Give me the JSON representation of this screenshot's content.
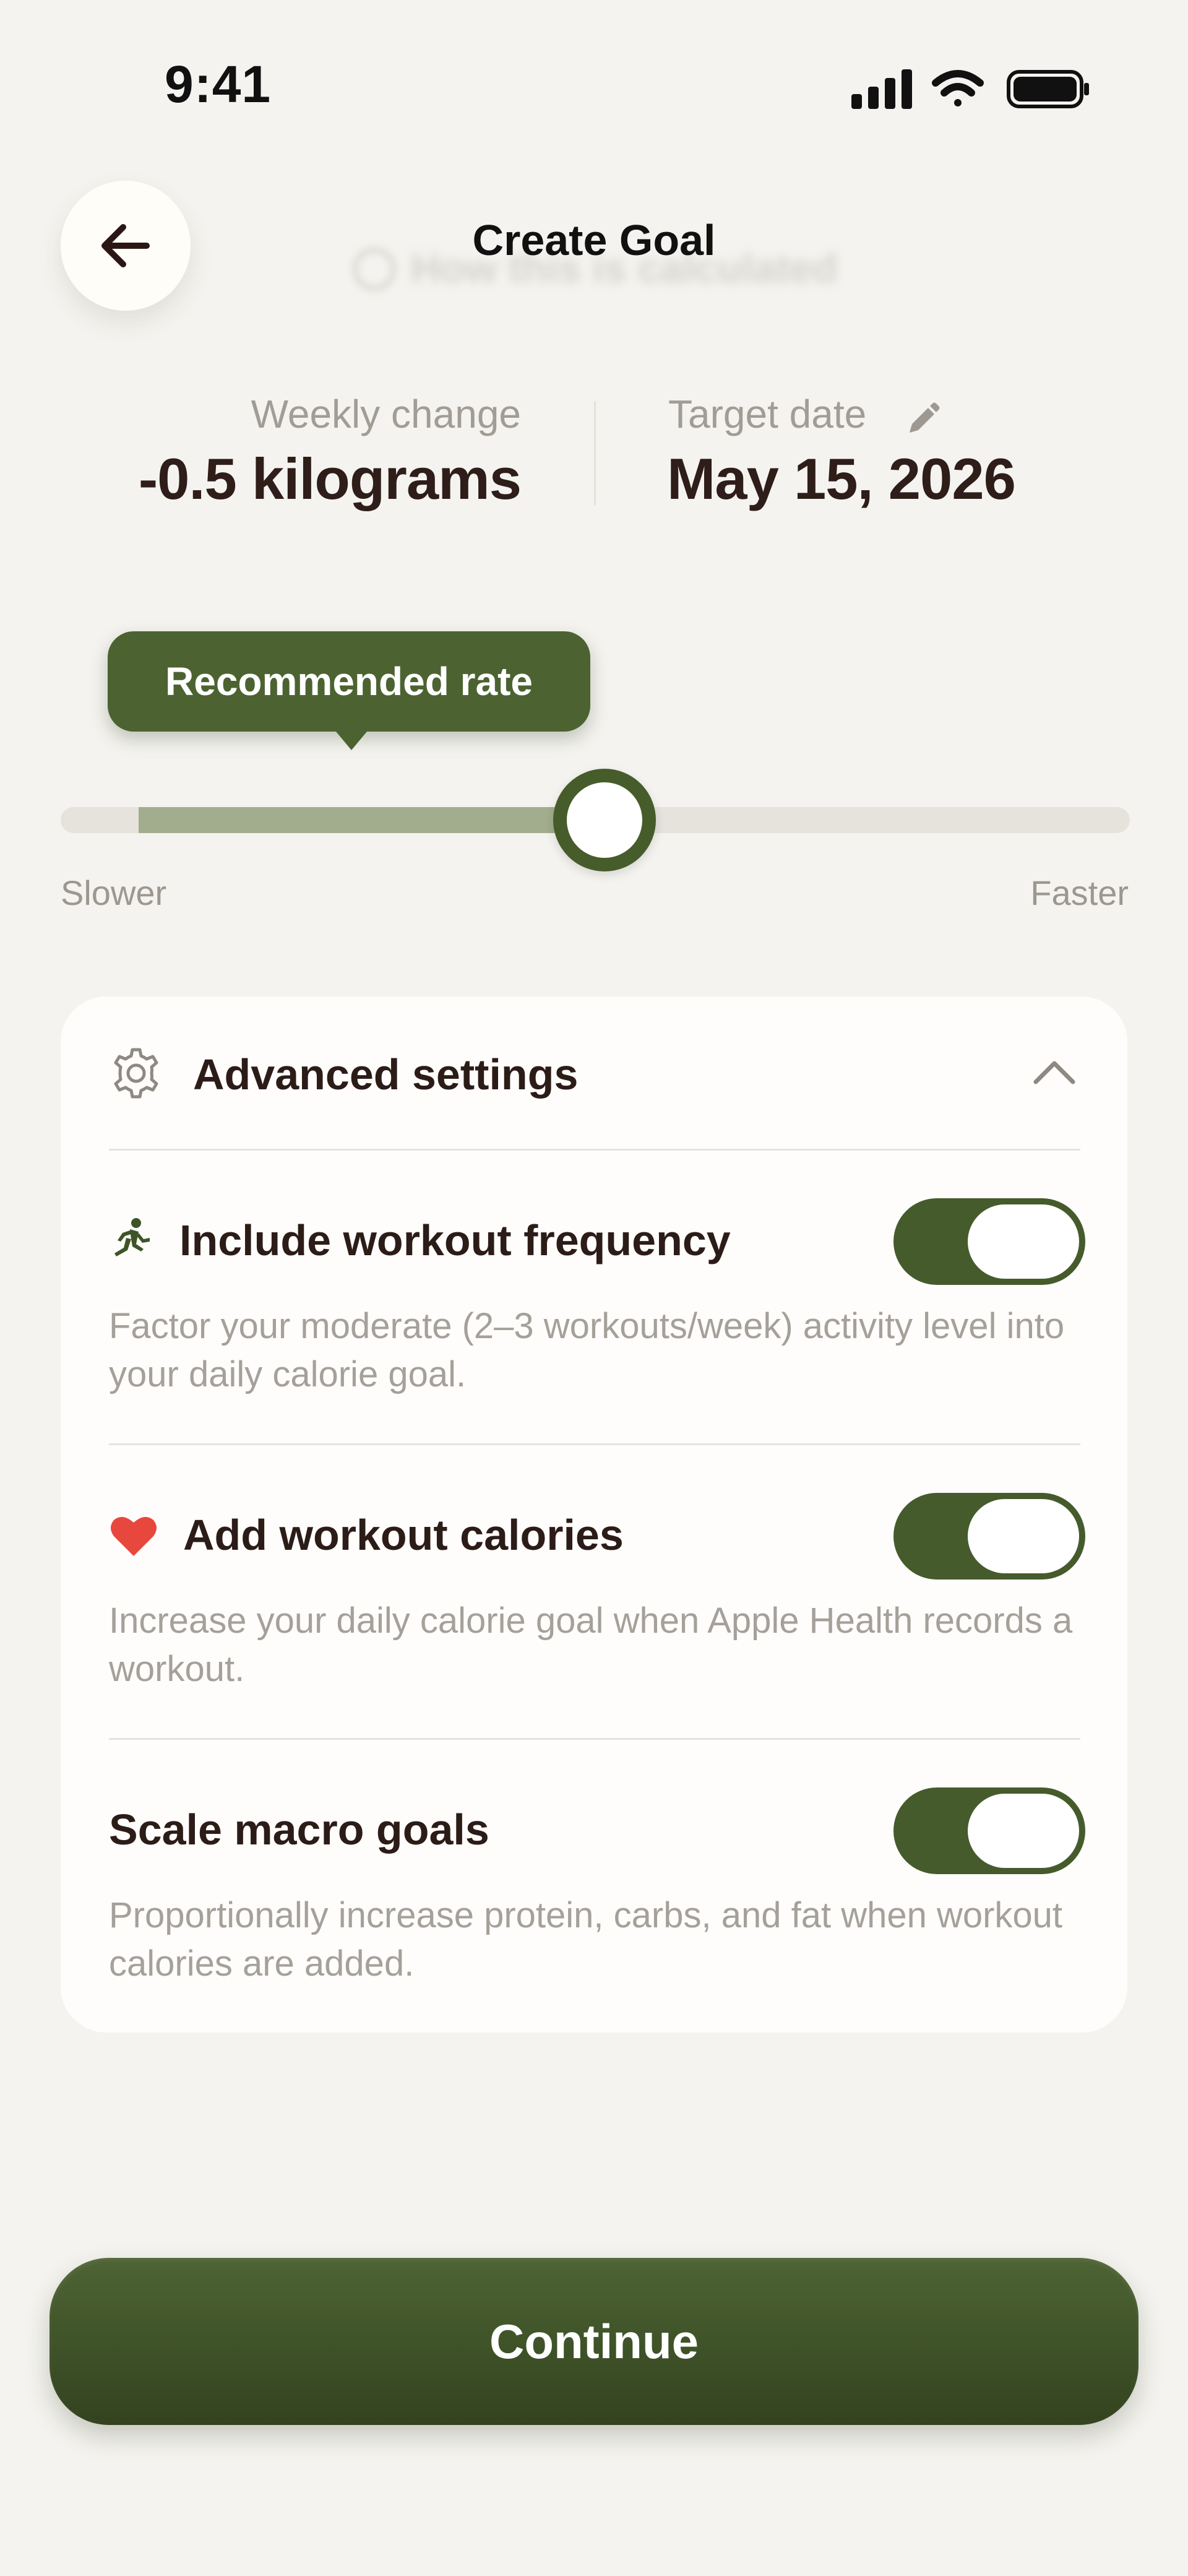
{
  "status_bar": {
    "time": "9:41",
    "icons": [
      "cellular-signal-icon",
      "wifi-icon",
      "battery-icon"
    ]
  },
  "header": {
    "title": "Create Goal",
    "back_icon": "arrow-left-icon",
    "background_hint": "How this is calculated"
  },
  "stats": {
    "weekly_change_label": "Weekly change",
    "weekly_change_value": "-0.5 kilograms",
    "target_date_label": "Target date",
    "target_date_value": "May 15, 2026",
    "edit_icon": "pencil-icon"
  },
  "rate_slider": {
    "tooltip": "Recommended rate",
    "min_label": "Slower",
    "max_label": "Faster",
    "value_fraction": 0.51,
    "recommended_range_fraction": [
      0.07,
      0.51
    ]
  },
  "advanced_settings": {
    "title": "Advanced settings",
    "expanded": true,
    "items": [
      {
        "title": "Include workout frequency",
        "icon": "running-person-icon",
        "description": "Factor your moderate (2–3 workouts/week) activity level into your daily calorie goal.",
        "enabled": true
      },
      {
        "title": "Add workout calories",
        "icon": "heart-icon",
        "description": "Increase your daily calorie goal when Apple Health records a workout.",
        "enabled": true
      },
      {
        "title": "Scale macro goals",
        "icon": "",
        "description": "Proportionally increase protein, carbs, and fat when workout calories are added.",
        "enabled": true
      }
    ]
  },
  "continue_button": {
    "label": "Continue"
  },
  "colors": {
    "background": "#f4f3ef",
    "accent_green": "#465c2b",
    "text_dark": "#2e1d19",
    "text_muted": "#a19c95",
    "heart_red": "#e8473e"
  }
}
